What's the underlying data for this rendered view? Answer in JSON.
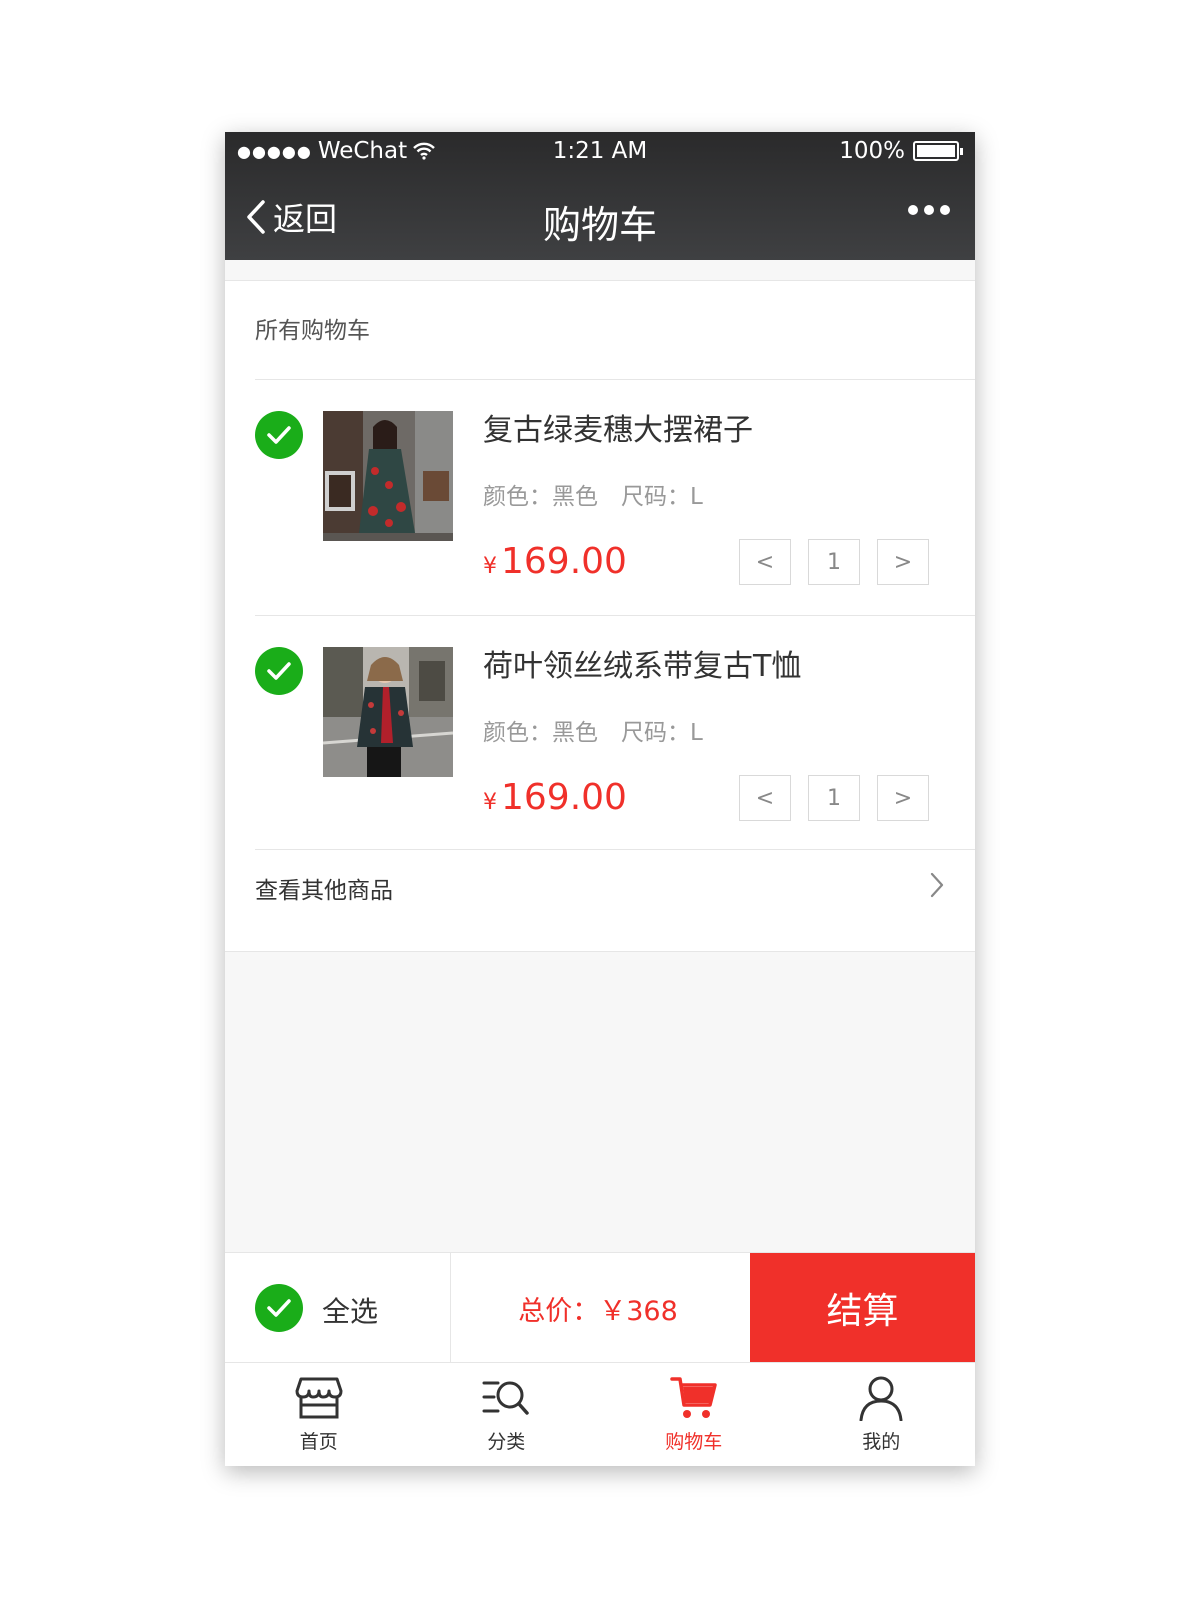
{
  "status_bar": {
    "carrier": "WeChat",
    "signal_dots": "●●●●●",
    "time": "1:21 AM",
    "battery": "100%",
    "icons": [
      "wifi-icon",
      "battery-icon"
    ]
  },
  "nav": {
    "back_label": "返回",
    "title": "购物车",
    "more_icon": "more-dots-icon"
  },
  "cart": {
    "section_title": "所有购物车",
    "items": [
      {
        "name": "复古绿麦穗大摆裙子",
        "spec": "颜色：黑色　尺码：L",
        "currency": "¥",
        "price": "169.00",
        "qty": "1",
        "dec": "<",
        "inc": ">"
      },
      {
        "name": "荷叶领丝绒系带复古T恤",
        "spec": "颜色：黑色　尺码：L",
        "currency": "¥",
        "price": "169.00",
        "qty": "1",
        "dec": "<",
        "inc": ">"
      }
    ],
    "other_label": "查看其他商品"
  },
  "checkout_bar": {
    "select_all": "全选",
    "total": "总价：￥368",
    "checkout": "结算"
  },
  "tabbar": {
    "items": [
      {
        "label": "首页",
        "icon": "store-icon"
      },
      {
        "label": "分类",
        "icon": "category-search-icon"
      },
      {
        "label": "购物车",
        "icon": "cart-icon"
      },
      {
        "label": "我的",
        "icon": "user-icon"
      }
    ]
  },
  "colors": {
    "accent": "#f0302a",
    "check": "#1aad19",
    "header": "#2f3032"
  }
}
